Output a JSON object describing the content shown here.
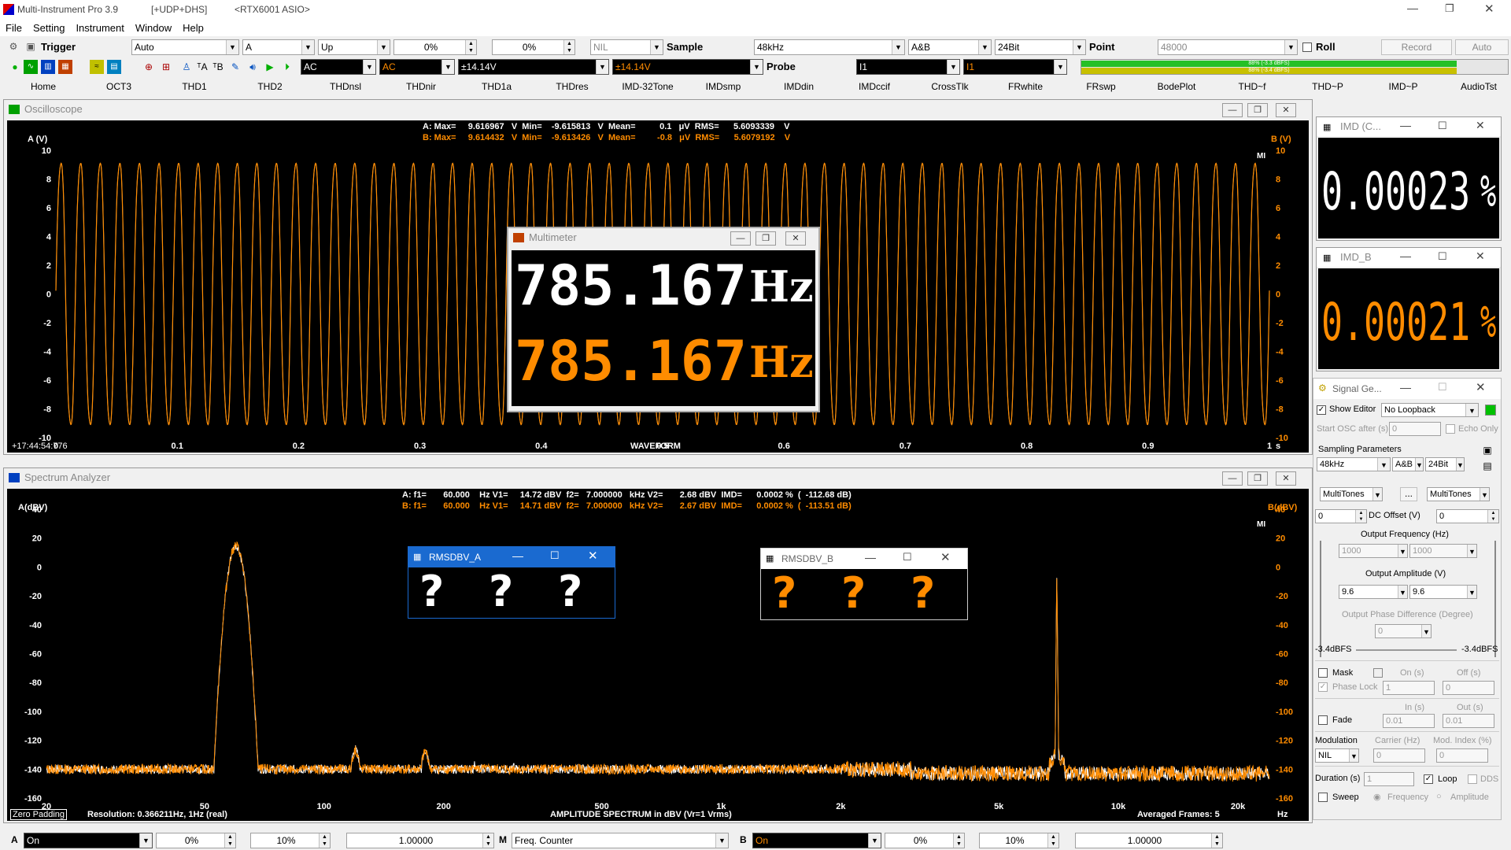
{
  "app": {
    "title": "Multi-Instrument Pro 3.9",
    "suffix1": "[+UDP+DHS]",
    "suffix2": "<RTX6001 ASIO>"
  },
  "menu": [
    "File",
    "Setting",
    "Instrument",
    "Window",
    "Help"
  ],
  "toolbar1": {
    "trigger_label": "Trigger",
    "trigger_mode": "Auto",
    "trigger_channel": "A",
    "trigger_edge": "Up",
    "trigger_level": "0%",
    "trigger_pos": "0%",
    "nil": "NIL",
    "sample_label": "Sample",
    "sample_rate": "48kHz",
    "channels": "A&B",
    "bits": "24Bit",
    "point_label": "Point",
    "points": "48000",
    "roll_label": "Roll",
    "record_label": "Record",
    "auto_label": "Auto"
  },
  "toolbar2": {
    "coupling_a": "AC",
    "coupling_b": "AC",
    "range_a": "±14.14V",
    "range_b": "±14.14V",
    "probe_label": "Probe",
    "probe_a": "I1",
    "probe_b": "I1",
    "meter_a": "88% (-3.3 dBFS)",
    "meter_b": "88% (-3.4 dBFS)"
  },
  "tabs": [
    "Home",
    "OCT3",
    "THD1",
    "THD2",
    "THDnsl",
    "THDnir",
    "THD1a",
    "THDres",
    "IMD-32Tone",
    "IMDsmp",
    "IMDdin",
    "IMDccif",
    "CrossTlk",
    "FRwhite",
    "FRswp",
    "BodePlot",
    "THD~f",
    "THD~P",
    "IMD~P",
    "AudioTst"
  ],
  "osc": {
    "title": "Oscilloscope",
    "ylabel_a": "A (V)",
    "ylabel_b": "B (V)",
    "stats_a": "A: Max=     9.616967   V  Min=    -9.615813   V  Mean=          0.1   μV  RMS=      5.6093339    V",
    "stats_b": "B: Max=     9.614432   V  Min=    -9.613426   V  Mean=         -0.8   μV  RMS=      5.6079192    V",
    "yticks": [
      "10",
      "8",
      "6",
      "4",
      "2",
      "0",
      "-2",
      "-4",
      "-6",
      "-8",
      "-10"
    ],
    "xticks": [
      "0",
      "0.1",
      "0.2",
      "0.3",
      "0.4",
      "0.5",
      "0.6",
      "0.7",
      "0.8",
      "0.9",
      "1"
    ],
    "xunit": "s",
    "time": "+17:44:54:776",
    "caption": "WAVEFORM",
    "badge": "MI"
  },
  "multimeter": {
    "title": "Multimeter",
    "value_a": "785.167",
    "value_b": "785.167",
    "unit": "Hz"
  },
  "imd_a": {
    "title": "IMD (C...",
    "value": "0.00023",
    "unit": "%"
  },
  "imd_b": {
    "title": "IMD_B",
    "value": "0.00021",
    "unit": "%"
  },
  "spec": {
    "title": "Spectrum Analyzer",
    "ylabel_a": "A(dBV)",
    "ylabel_b": "B(dBV)",
    "stats_a": "A: f1=       60.000    Hz V1=     14.72 dBV  f2=   7.000000   kHz V2=       2.68 dBV  IMD=      0.0002 %  (  -112.68 dB)",
    "stats_b": "B: f1=       60.000    Hz V1=     14.71 dBV  f2=   7.000000   kHz V2=       2.67 dBV  IMD=      0.0002 %  (  -113.51 dB)",
    "yticks": [
      "40",
      "20",
      "0",
      "-20",
      "-40",
      "-60",
      "-80",
      "-100",
      "-120",
      "-140",
      "-160"
    ],
    "xticks": [
      "20",
      "50",
      "100",
      "200",
      "500",
      "1k",
      "2k",
      "5k",
      "10k",
      "20k"
    ],
    "xunit": "Hz",
    "zero_padding": "Zero Padding",
    "resolution": "Resolution: 0.366211Hz, 1Hz (real)",
    "caption": "AMPLITUDE SPECTRUM in dBV (Vr=1 Vrms)",
    "frames": "Averaged Frames: 5",
    "badge": "MI"
  },
  "rms_a": {
    "title": "RMSDBV_A"
  },
  "rms_b": {
    "title": "RMSDBV_B"
  },
  "siggen": {
    "title": "Signal Ge...",
    "show_editor": "Show Editor",
    "loopback": "No Loopback",
    "start_osc": "Start OSC after (s)",
    "start_val": "0",
    "echo_only": "Echo Only",
    "sampling_params": "Sampling Parameters",
    "rate": "48kHz",
    "channels": "A&B",
    "bits": "24Bit",
    "wave_a": "MultiTones",
    "dots": "...",
    "wave_b": "MultiTones",
    "dc_a": "0",
    "dc_label": "DC Offset (V)",
    "dc_b": "0",
    "freq_label": "Output Frequency (Hz)",
    "freq_a": "1000",
    "freq_b": "1000",
    "amp_label": "Output Amplitude (V)",
    "amp_a": "9.6",
    "amp_b": "9.6",
    "phase_label": "Output Phase Difference (Degree)",
    "phase_val": "0",
    "dbfs_a": "-3.4dBFS",
    "dbfs_b": "-3.4dBFS",
    "mask": "Mask",
    "on_s": "On (s)",
    "off_s": "Off (s)",
    "phase_lock": "Phase Lock",
    "on_val": "1",
    "off_val": "0",
    "fade": "Fade",
    "in_s": "In (s)",
    "out_s": "Out (s)",
    "in_val": "0.01",
    "out_val": "0.01",
    "modulation": "Modulation",
    "carrier": "Carrier (Hz)",
    "mod_index": "Mod. Index (%)",
    "mod_val": "NIL",
    "carrier_val": "0",
    "index_val": "0",
    "duration": "Duration (s)",
    "duration_val": "1",
    "loop": "Loop",
    "dds": "DDS",
    "sweep": "Sweep",
    "frequency": "Frequency",
    "amplitude": "Amplitude"
  },
  "bottom": {
    "a_label": "A",
    "a_on": "On",
    "a_pct1": "0%",
    "a_pct2": "10%",
    "a_gain": "1.00000",
    "m_label": "M",
    "m_mode": "Freq. Counter",
    "b_label": "B",
    "b_on": "On",
    "b_pct1": "0%",
    "b_pct2": "10%",
    "b_gain": "1.00000"
  },
  "colors": {
    "a": "#ffffff",
    "b": "#ff8c00",
    "accent": "#00b000"
  }
}
